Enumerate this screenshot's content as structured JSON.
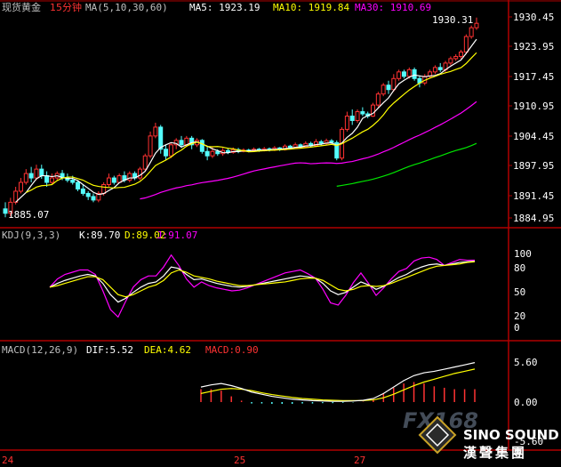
{
  "header": {
    "symbol": "现货黄金",
    "period": "15分钟",
    "ma_params": "MA(5,10,30,60)",
    "ma5": "MA5: 1923.19",
    "ma10": "MA10: 1919.84",
    "ma30": "MA30: 1910.69"
  },
  "colors": {
    "background": "#000000",
    "grid": "#b00000",
    "up": "#ff3232",
    "down": "#54fcfc",
    "ma5": "#ffffff",
    "ma10": "#ffff00",
    "ma30": "#ff00ff",
    "ma60": "#00e600",
    "text": "#c0c0c0",
    "period": "#ff3232"
  },
  "price_panel": {
    "ticks": [
      "1930.45",
      "1923.95",
      "1917.45",
      "1910.95",
      "1904.45",
      "1897.95",
      "1891.45",
      "1884.95"
    ],
    "high_label": "1930.31",
    "low_label": "1885.07"
  },
  "kdj_panel": {
    "params": "KDJ(9,3,3)",
    "k": "K:89.70",
    "d": "D:89.02",
    "j": "J:91.07",
    "ticks": [
      "100",
      "80",
      "50",
      "20",
      "0"
    ]
  },
  "macd_panel": {
    "params": "MACD(12,26,9)",
    "dif": "DIF:5.52",
    "dea": "DEA:4.62",
    "macd": "MACD:0.90",
    "ticks": [
      "5.60",
      "0.00",
      "-5.60"
    ]
  },
  "date_axis": {
    "labels": [
      "24",
      "25",
      "27"
    ]
  },
  "watermark": {
    "fx": "FX168",
    "brand": "SINO SOUND",
    "cn": "漢聲集團"
  },
  "chart_data": {
    "type": "candlestick",
    "series": [
      {
        "name": "MA5"
      },
      {
        "name": "MA10"
      },
      {
        "name": "MA30"
      }
    ],
    "y_range": [
      1884.95,
      1930.45
    ],
    "candles": [
      [
        1887.0,
        1886.0,
        1888.5,
        1885.1
      ],
      [
        1886.0,
        1888.5,
        1889.5,
        1885.3
      ],
      [
        1888.5,
        1891.0,
        1892.0,
        1888.0
      ],
      [
        1891.0,
        1893.0,
        1894.0,
        1890.5
      ],
      [
        1893.0,
        1895.0,
        1896.0,
        1892.5
      ],
      [
        1895.0,
        1894.0,
        1896.5,
        1893.0
      ],
      [
        1894.0,
        1896.0,
        1897.0,
        1893.5
      ],
      [
        1896.0,
        1894.5,
        1897.0,
        1893.8
      ],
      [
        1894.5,
        1893.0,
        1895.5,
        1892.0
      ],
      [
        1893.0,
        1894.0,
        1895.0,
        1892.5
      ],
      [
        1894.0,
        1895.0,
        1895.5,
        1893.5
      ],
      [
        1895.0,
        1894.0,
        1895.8,
        1893.5
      ],
      [
        1894.0,
        1893.5,
        1895.0,
        1893.0
      ],
      [
        1893.5,
        1893.0,
        1894.5,
        1892.5
      ],
      [
        1893.0,
        1891.5,
        1893.5,
        1891.0
      ],
      [
        1891.5,
        1890.5,
        1892.5,
        1890.0
      ],
      [
        1890.5,
        1889.8,
        1891.0,
        1889.0
      ],
      [
        1889.8,
        1889.0,
        1890.5,
        1888.5
      ],
      [
        1889.0,
        1890.5,
        1891.0,
        1888.5
      ],
      [
        1890.5,
        1892.5,
        1893.0,
        1890.0
      ],
      [
        1892.5,
        1894.0,
        1895.0,
        1892.0
      ],
      [
        1894.0,
        1893.0,
        1894.5,
        1892.5
      ],
      [
        1893.0,
        1894.5,
        1895.0,
        1892.8
      ],
      [
        1894.5,
        1893.5,
        1895.5,
        1893.0
      ],
      [
        1893.5,
        1895.0,
        1895.5,
        1893.0
      ],
      [
        1895.0,
        1894.0,
        1895.5,
        1893.5
      ],
      [
        1894.0,
        1896.0,
        1896.5,
        1893.5
      ],
      [
        1896.0,
        1899.0,
        1899.5,
        1895.5
      ],
      [
        1899.0,
        1903.5,
        1904.5,
        1898.5
      ],
      [
        1903.5,
        1905.5,
        1906.5,
        1903.0
      ],
      [
        1905.5,
        1900.5,
        1906.0,
        1899.5
      ],
      [
        1900.5,
        1899.0,
        1901.5,
        1898.0
      ],
      [
        1899.0,
        1901.5,
        1902.0,
        1898.5
      ],
      [
        1901.5,
        1902.5,
        1903.0,
        1900.5
      ],
      [
        1902.5,
        1901.5,
        1903.5,
        1900.8
      ],
      [
        1901.5,
        1903.0,
        1903.5,
        1901.0
      ],
      [
        1903.0,
        1901.5,
        1903.5,
        1900.5
      ],
      [
        1901.5,
        1902.5,
        1903.0,
        1901.0
      ],
      [
        1902.5,
        1900.0,
        1902.8,
        1899.5
      ],
      [
        1900.0,
        1899.0,
        1901.0,
        1898.0
      ],
      [
        1899.0,
        1900.0,
        1901.0,
        1898.5
      ],
      [
        1900.0,
        1899.5,
        1900.5,
        1899.0
      ],
      [
        1899.5,
        1900.2,
        1900.8,
        1899.0
      ],
      [
        1900.2,
        1899.8,
        1900.6,
        1899.4
      ],
      [
        1899.8,
        1900.4,
        1900.9,
        1899.5
      ],
      [
        1900.4,
        1900.0,
        1900.8,
        1899.6
      ],
      [
        1900.0,
        1900.3,
        1900.7,
        1899.8
      ],
      [
        1900.3,
        1900.1,
        1900.6,
        1899.8
      ],
      [
        1900.1,
        1900.5,
        1900.9,
        1899.9
      ],
      [
        1900.5,
        1900.2,
        1900.8,
        1899.9
      ],
      [
        1900.2,
        1900.6,
        1901.0,
        1900.0
      ],
      [
        1900.6,
        1900.3,
        1900.9,
        1900.0
      ],
      [
        1900.3,
        1900.8,
        1901.2,
        1900.1
      ],
      [
        1900.8,
        1900.4,
        1901.0,
        1900.1
      ],
      [
        1900.4,
        1901.2,
        1901.6,
        1900.2
      ],
      [
        1901.2,
        1900.8,
        1901.5,
        1900.5
      ],
      [
        1900.8,
        1901.5,
        1902.0,
        1900.6
      ],
      [
        1901.5,
        1901.0,
        1901.8,
        1900.7
      ],
      [
        1901.0,
        1901.8,
        1902.3,
        1900.8
      ],
      [
        1901.8,
        1901.3,
        1902.2,
        1901.0
      ],
      [
        1901.3,
        1902.2,
        1902.8,
        1901.0
      ],
      [
        1902.2,
        1901.8,
        1902.6,
        1901.4
      ],
      [
        1901.8,
        1902.4,
        1902.9,
        1901.5
      ],
      [
        1902.4,
        1902.0,
        1902.8,
        1901.7
      ],
      [
        1902.0,
        1898.5,
        1902.5,
        1898.0
      ],
      [
        1898.5,
        1905.0,
        1905.5,
        1898.0
      ],
      [
        1905.0,
        1908.0,
        1909.0,
        1904.5
      ],
      [
        1908.0,
        1907.0,
        1909.5,
        1906.0
      ],
      [
        1907.0,
        1909.0,
        1909.5,
        1906.5
      ],
      [
        1909.0,
        1908.5,
        1910.0,
        1908.0
      ],
      [
        1908.5,
        1908.0,
        1909.0,
        1907.5
      ],
      [
        1908.0,
        1910.5,
        1911.0,
        1907.8
      ],
      [
        1910.5,
        1913.0,
        1913.5,
        1910.0
      ],
      [
        1913.0,
        1915.0,
        1915.5,
        1912.5
      ],
      [
        1915.0,
        1914.0,
        1916.0,
        1913.0
      ],
      [
        1914.0,
        1916.5,
        1917.5,
        1913.5
      ],
      [
        1916.5,
        1918.0,
        1918.5,
        1916.0
      ],
      [
        1918.0,
        1917.0,
        1918.5,
        1916.5
      ],
      [
        1917.0,
        1918.5,
        1919.0,
        1916.5
      ],
      [
        1918.5,
        1916.5,
        1919.0,
        1916.0
      ],
      [
        1916.5,
        1915.5,
        1917.0,
        1914.5
      ],
      [
        1915.5,
        1917.0,
        1917.5,
        1915.0
      ],
      [
        1917.0,
        1918.0,
        1918.5,
        1916.5
      ],
      [
        1918.0,
        1919.0,
        1919.5,
        1917.5
      ],
      [
        1919.0,
        1918.5,
        1920.0,
        1918.0
      ],
      [
        1918.5,
        1920.0,
        1920.5,
        1918.0
      ],
      [
        1920.0,
        1921.0,
        1921.5,
        1919.5
      ],
      [
        1921.0,
        1921.5,
        1922.0,
        1920.5
      ],
      [
        1921.5,
        1922.5,
        1923.0,
        1921.0
      ],
      [
        1922.5,
        1926.0,
        1926.5,
        1922.0
      ],
      [
        1926.0,
        1928.0,
        1928.5,
        1925.5
      ],
      [
        1928.0,
        1929.0,
        1930.3,
        1927.5
      ]
    ],
    "kdj": {
      "k": [
        55,
        60,
        64,
        67,
        70,
        72,
        70,
        60,
        45,
        35,
        40,
        48,
        55,
        60,
        62,
        70,
        82,
        80,
        72,
        65,
        66,
        63,
        60,
        58,
        56,
        55,
        56,
        58,
        60,
        62,
        64,
        66,
        68,
        70,
        69,
        67,
        60,
        50,
        45,
        48,
        55,
        62,
        58,
        52,
        56,
        62,
        68,
        72,
        78,
        82,
        85,
        86,
        84,
        86,
        88,
        89,
        89.7
      ],
      "d": [
        55,
        57,
        60,
        63,
        66,
        69,
        69,
        65,
        55,
        45,
        42,
        45,
        50,
        55,
        58,
        64,
        74,
        78,
        75,
        70,
        68,
        66,
        63,
        61,
        59,
        57,
        57,
        58,
        59,
        60,
        61,
        62,
        64,
        66,
        67,
        67,
        64,
        58,
        52,
        50,
        52,
        56,
        57,
        56,
        57,
        60,
        64,
        68,
        72,
        76,
        80,
        83,
        84,
        85,
        86,
        88,
        89
      ],
      "j": [
        55,
        66,
        72,
        75,
        78,
        78,
        72,
        50,
        25,
        15,
        36,
        55,
        65,
        70,
        70,
        82,
        98,
        84,
        66,
        55,
        62,
        57,
        54,
        52,
        50,
        51,
        54,
        58,
        62,
        66,
        70,
        74,
        76,
        78,
        73,
        67,
        52,
        34,
        31,
        44,
        61,
        74,
        60,
        44,
        54,
        66,
        76,
        80,
        90,
        94,
        95,
        92,
        84,
        88,
        92,
        91,
        91.07
      ]
    },
    "macd": {
      "dif": [
        2.1,
        2.4,
        2.6,
        2.3,
        1.9,
        1.4,
        1.1,
        0.8,
        0.6,
        0.4,
        0.3,
        0.2,
        0.15,
        0.1,
        0.1,
        0.15,
        0.25,
        0.5,
        1.2,
        2.1,
        3.0,
        3.7,
        4.1,
        4.3,
        4.6,
        4.9,
        5.2,
        5.52
      ],
      "dea": [
        1.2,
        1.5,
        1.8,
        1.9,
        1.8,
        1.6,
        1.3,
        1.05,
        0.85,
        0.65,
        0.5,
        0.4,
        0.3,
        0.25,
        0.2,
        0.2,
        0.22,
        0.3,
        0.6,
        1.1,
        1.7,
        2.3,
        2.8,
        3.2,
        3.6,
        4.0,
        4.3,
        4.62
      ],
      "macd": [
        1.8,
        1.8,
        1.6,
        0.8,
        0.2,
        -0.2,
        -0.2,
        -0.25,
        -0.25,
        -0.25,
        -0.2,
        -0.2,
        -0.15,
        -0.15,
        -0.1,
        -0.05,
        0.05,
        0.4,
        1.2,
        2.0,
        2.6,
        2.8,
        2.6,
        2.2,
        2.0,
        1.8,
        1.8,
        1.8
      ]
    }
  }
}
